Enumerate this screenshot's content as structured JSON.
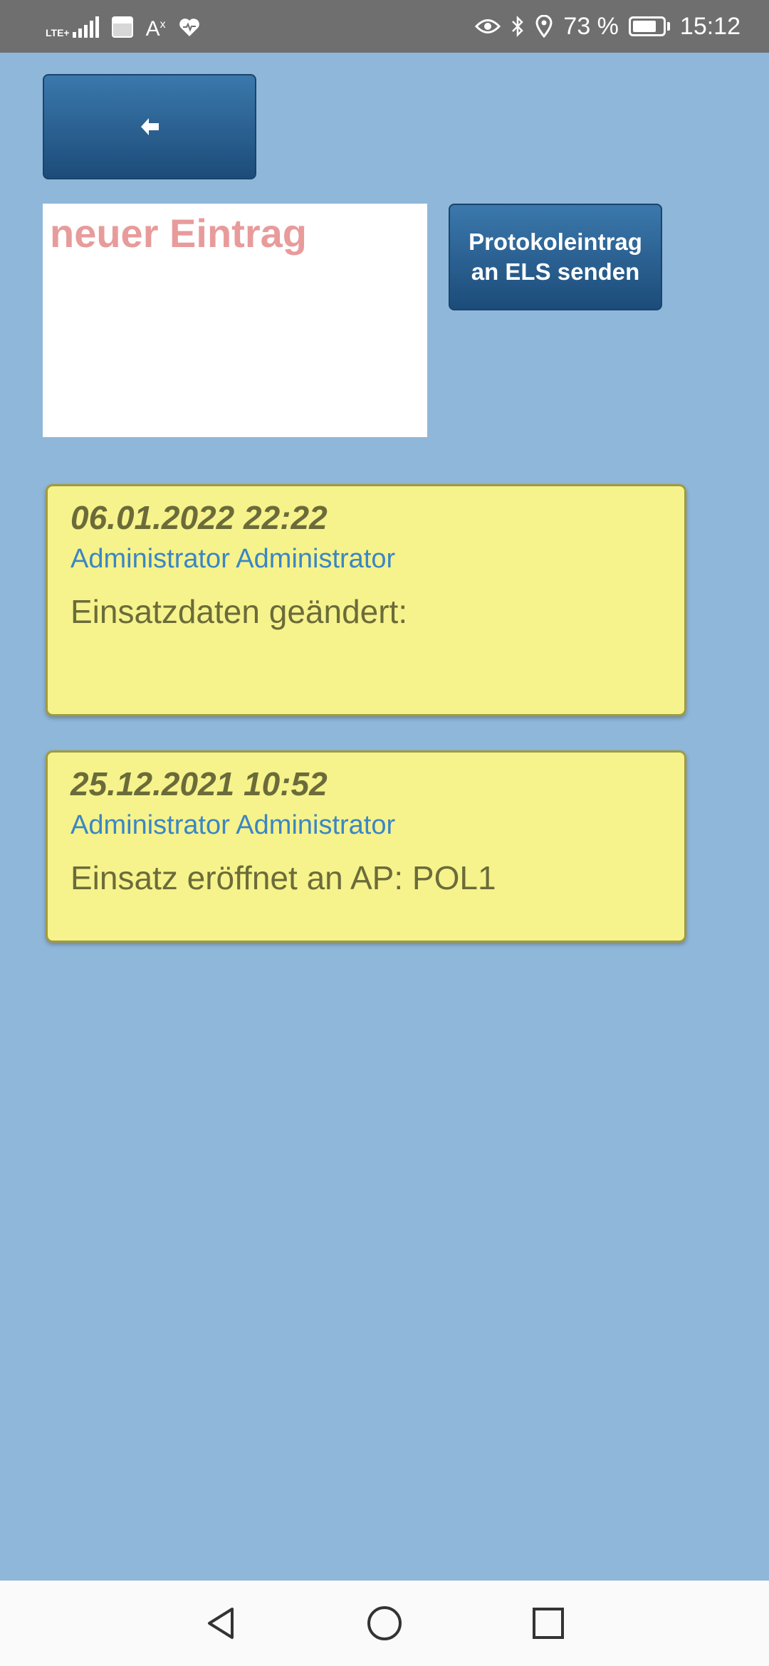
{
  "status_bar": {
    "network": "LTE+",
    "accessibility": "A",
    "battery_percent": "73 %",
    "time": "15:12",
    "icons": [
      "lte-icon",
      "signal-icon",
      "calendar-icon",
      "accessibility-icon",
      "health-icon",
      "eye-icon",
      "bluetooth-icon",
      "location-icon",
      "battery-icon"
    ]
  },
  "toolbar": {
    "back_icon": "arrow-left-icon"
  },
  "entry": {
    "placeholder": "neuer Eintrag",
    "send_label": "Protokoleintrag an ELS senden"
  },
  "log": [
    {
      "date": "06.01.2022 22:22",
      "author": "Administrator Administrator",
      "text": "Einsatzdaten geändert:"
    },
    {
      "date": "25.12.2021 10:52",
      "author": "Administrator Administrator",
      "text": "Einsatz eröffnet an AP: POL1"
    }
  ],
  "colors": {
    "background": "#8fb7d9",
    "button": "#2a5f91",
    "entry_card": "#f6f38c",
    "author": "#3b86c4",
    "placeholder": "#e89b9b"
  },
  "nav_bar": {
    "icons": [
      "nav-back-icon",
      "nav-home-icon",
      "nav-recent-icon"
    ]
  }
}
